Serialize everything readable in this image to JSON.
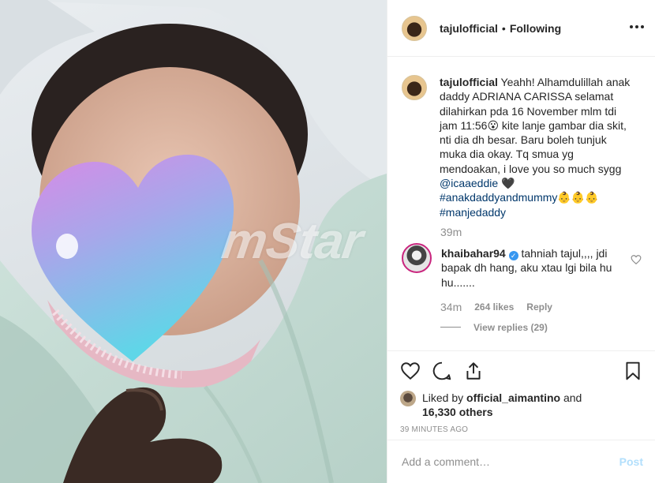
{
  "post": {
    "author": "tajulofficial",
    "separator": "•",
    "follow_status": "Following",
    "watermark": "mStar",
    "caption": {
      "author": "tajulofficial",
      "text": "Yeahh! Alhamdulillah anak daddy ADRIANA CARISSA selamat dilahirkan pda 16 November mlm tdi jam 11:56😮 kite lanje gambar dia skit, nti dia dh besar. Baru boleh tunjuk muka dia okay. Tq smua yg mendoakan, i love you so much sygg",
      "mention": "@icaaeddie",
      "heart": "🖤",
      "hashtag1": "#anakdaddyandmummy👶👶👶",
      "hashtag2": "#manjedaddy",
      "time": "39m"
    },
    "reply": {
      "author": "khaibahar94",
      "verified_mark": "✓",
      "text": "tahniah tajul,,,, jdi bapak dh hang, aku xtau lgi bila hu hu.......",
      "time": "34m",
      "likes": "264 likes",
      "reply_label": "Reply",
      "view_replies": "View replies (29)"
    },
    "likes": {
      "prefix": "Liked by",
      "user": "official_aimantino",
      "and": "and",
      "others": "16,330 others"
    },
    "timestamp": "39 MINUTES AGO"
  },
  "comment_box": {
    "placeholder": "Add a comment…",
    "post_label": "Post"
  },
  "colors": {
    "link": "#00376b",
    "muted": "#8e8e8e",
    "post_disabled": "#b2dffc",
    "verified": "#3897f0"
  },
  "icons": [
    "more-icon",
    "heart-icon",
    "comment-icon",
    "share-icon",
    "bookmark-icon",
    "verified-icon"
  ]
}
